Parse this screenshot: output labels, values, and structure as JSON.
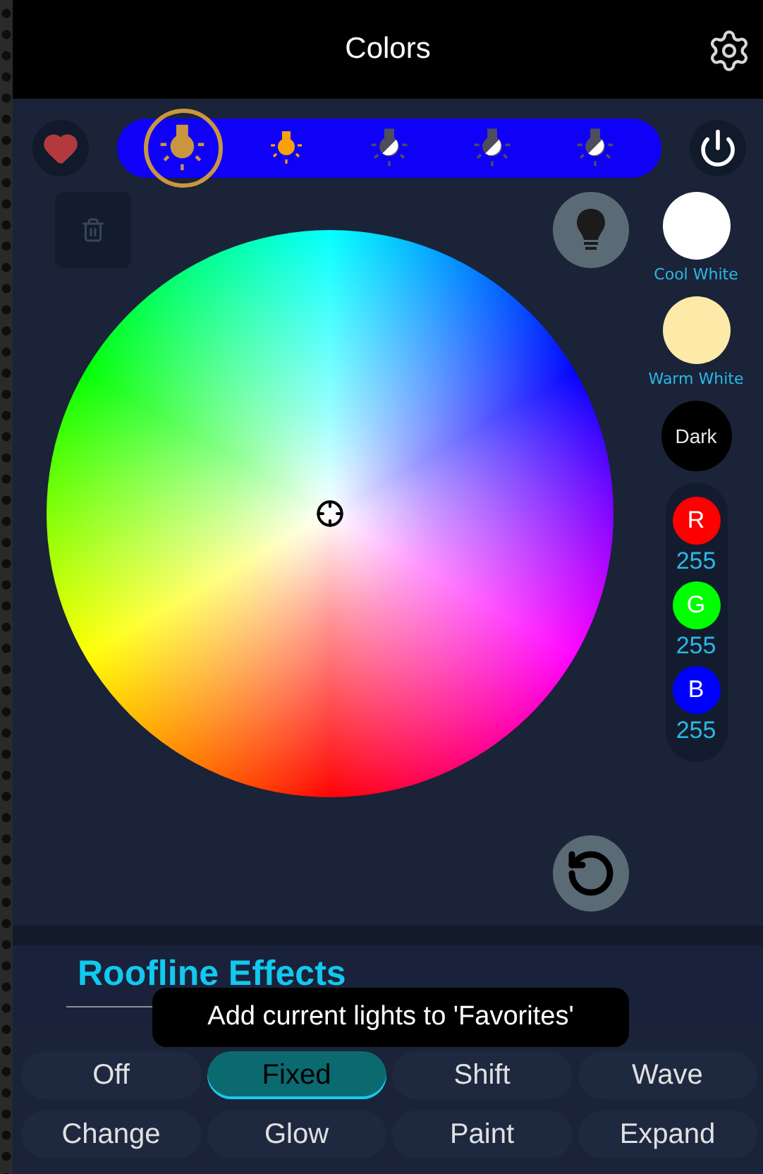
{
  "header": {
    "title": "Colors"
  },
  "lights": [
    {
      "kind": "on",
      "selected": true
    },
    {
      "kind": "on",
      "selected": false
    },
    {
      "kind": "split",
      "selected": false
    },
    {
      "kind": "split",
      "selected": false
    },
    {
      "kind": "split",
      "selected": false
    }
  ],
  "presets": [
    {
      "label": "Cool White",
      "color": "#ffffff"
    },
    {
      "label": "Warm White",
      "color": "#fdeaa8"
    }
  ],
  "dark_button": {
    "label": "Dark"
  },
  "rgb": [
    {
      "channel": "R",
      "value": "255",
      "color": "#ff0000"
    },
    {
      "channel": "G",
      "value": "255",
      "color": "#00ff00"
    },
    {
      "channel": "B",
      "value": "255",
      "color": "#0000ff"
    }
  ],
  "effects": {
    "title": "Roofline Effects",
    "buttons": [
      {
        "label": "Off",
        "selected": false
      },
      {
        "label": "Fixed",
        "selected": true
      },
      {
        "label": "Shift",
        "selected": false
      },
      {
        "label": "Wave",
        "selected": false
      },
      {
        "label": "Change",
        "selected": false
      },
      {
        "label": "Glow",
        "selected": false
      },
      {
        "label": "Paint",
        "selected": false
      },
      {
        "label": "Expand",
        "selected": false
      }
    ]
  },
  "tooltip": {
    "text": "Add current lights to 'Favorites'"
  }
}
